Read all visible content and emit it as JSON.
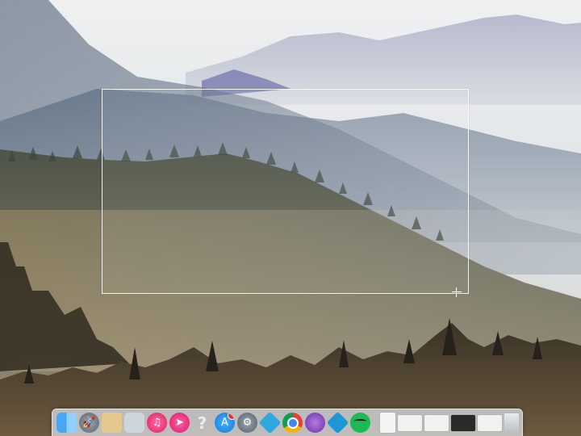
{
  "screen": {
    "wallpaper": "misty-mountain-forest"
  },
  "selection": {
    "cursor_icon": "crosshair-icon",
    "coords_text": ""
  },
  "dock": {
    "items": [
      {
        "name": "finder",
        "icon": "finder-icon"
      },
      {
        "name": "launchpad",
        "icon": "rocket-icon"
      },
      {
        "name": "notes",
        "icon": "notes-icon"
      },
      {
        "name": "photos",
        "icon": "photos-icon"
      },
      {
        "name": "itunes",
        "icon": "music-note-icon",
        "glyph": "♫"
      },
      {
        "name": "arrow-app",
        "icon": "arrow-icon",
        "glyph": "➤"
      },
      {
        "name": "help",
        "icon": "question-icon",
        "glyph": "?"
      },
      {
        "name": "app-store",
        "icon": "app-store-icon",
        "glyph": "A"
      },
      {
        "name": "system-preferences",
        "icon": "gear-icon",
        "glyph": "⚙"
      },
      {
        "name": "teal-app-1",
        "icon": "diamond-icon"
      },
      {
        "name": "chrome",
        "icon": "chrome-icon"
      },
      {
        "name": "spiral-app",
        "icon": "spiral-icon"
      },
      {
        "name": "teal-app-2",
        "icon": "diamond-icon"
      },
      {
        "name": "spotify",
        "icon": "spotify-icon"
      },
      {
        "name": "document",
        "icon": "document-icon"
      },
      {
        "name": "window-thumb-1",
        "icon": "window-thumbnail-icon"
      },
      {
        "name": "window-thumb-2",
        "icon": "window-thumbnail-icon"
      },
      {
        "name": "window-thumb-3",
        "icon": "window-thumbnail-icon"
      },
      {
        "name": "window-thumb-4",
        "icon": "window-thumbnail-icon"
      },
      {
        "name": "trash",
        "icon": "trash-icon"
      }
    ]
  }
}
